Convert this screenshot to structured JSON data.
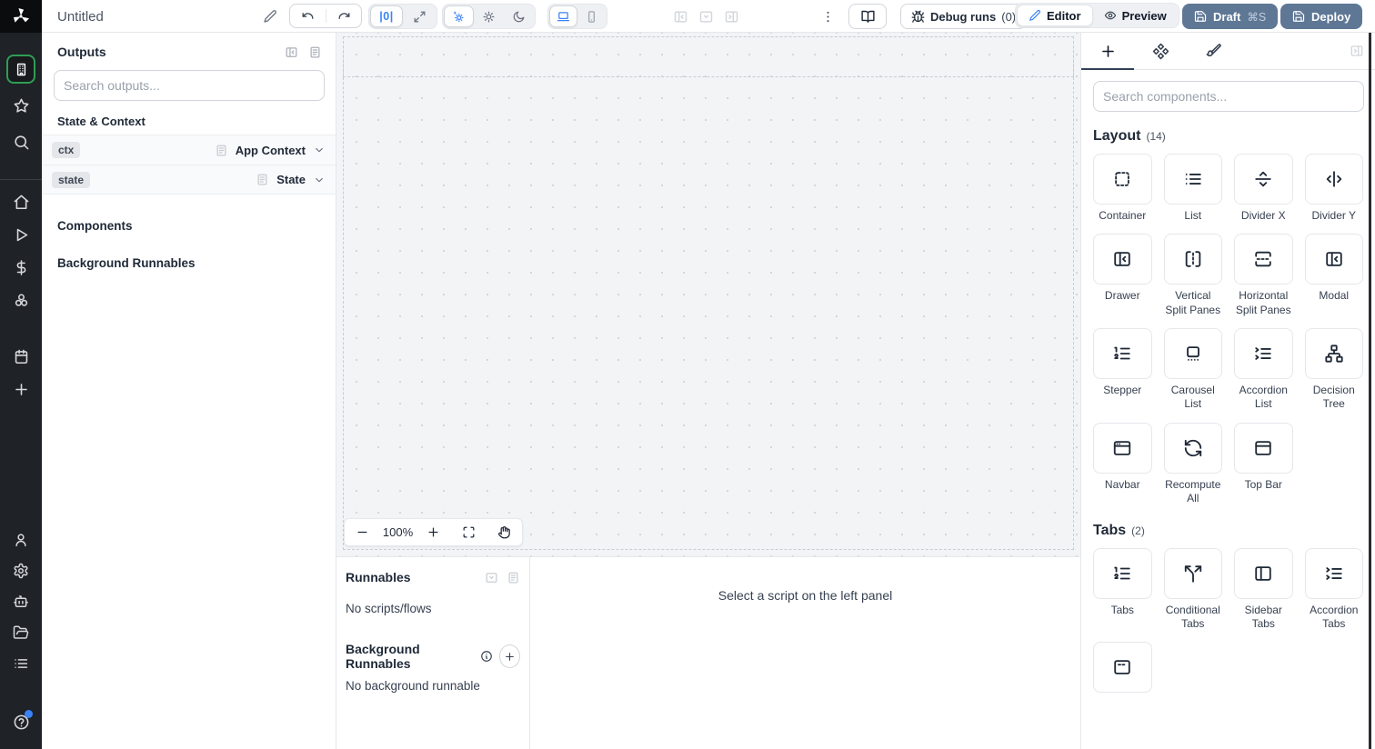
{
  "topbar": {
    "title": "Untitled",
    "zoom_reset_label": "|0|",
    "debug_runs_label": "Debug runs",
    "debug_runs_count": "(0)",
    "editor_label": "Editor",
    "preview_label": "Preview",
    "draft_label": "Draft",
    "draft_shortcut": "⌘S",
    "deploy_label": "Deploy"
  },
  "sidebar": {
    "top_icons": [
      {
        "icon": "app-builder",
        "active": true
      },
      {
        "icon": "star"
      },
      {
        "icon": "search"
      }
    ],
    "mid_icons": [
      {
        "icon": "home"
      },
      {
        "icon": "play"
      },
      {
        "icon": "dollar"
      },
      {
        "icon": "resources"
      }
    ],
    "lower_icons": [
      {
        "icon": "calendar"
      },
      {
        "icon": "plus"
      }
    ],
    "bottom_icons": [
      {
        "icon": "user"
      },
      {
        "icon": "gear"
      },
      {
        "icon": "robot"
      },
      {
        "icon": "folder"
      },
      {
        "icon": "list-menu"
      }
    ],
    "help_icon": "help"
  },
  "outputs": {
    "title": "Outputs",
    "search_placeholder": "Search outputs...",
    "state_context_header": "State & Context",
    "rows": [
      {
        "badge": "ctx",
        "label": "App Context"
      },
      {
        "badge": "state",
        "label": "State"
      }
    ],
    "components_header": "Components",
    "background_header": "Background Runnables"
  },
  "canvas": {
    "zoom_level": "100%"
  },
  "runnables": {
    "title": "Runnables",
    "no_scripts": "No scripts/flows",
    "background_title": "Background Runnables",
    "no_background": "No background runnable",
    "select_hint": "Select a script on the left panel"
  },
  "components_panel": {
    "search_placeholder": "Search components...",
    "sections": [
      {
        "title": "Layout",
        "count": "(14)",
        "items": [
          {
            "label": "Container",
            "icon": "container"
          },
          {
            "label": "List",
            "icon": "list"
          },
          {
            "label": "Divider X",
            "icon": "divider-x"
          },
          {
            "label": "Divider Y",
            "icon": "divider-y"
          },
          {
            "label": "Drawer",
            "icon": "drawer"
          },
          {
            "label": "Vertical Split Panes",
            "icon": "vsplit"
          },
          {
            "label": "Horizontal Split Panes",
            "icon": "hsplit"
          },
          {
            "label": "Modal",
            "icon": "modal"
          },
          {
            "label": "Stepper",
            "icon": "stepper"
          },
          {
            "label": "Carousel List",
            "icon": "carousel"
          },
          {
            "label": "Accordion List",
            "icon": "accordion-list"
          },
          {
            "label": "Decision Tree",
            "icon": "decision-tree"
          },
          {
            "label": "Navbar",
            "icon": "navbar"
          },
          {
            "label": "Recompute All",
            "icon": "recompute"
          },
          {
            "label": "Top Bar",
            "icon": "top-bar"
          }
        ]
      },
      {
        "title": "Tabs",
        "count": "(2)",
        "items": [
          {
            "label": "Tabs",
            "icon": "tabs"
          },
          {
            "label": "Conditional Tabs",
            "icon": "conditional-tabs"
          },
          {
            "label": "Sidebar Tabs",
            "icon": "sidebar-tabs"
          },
          {
            "label": "Accordion Tabs",
            "icon": "accordion-tabs"
          },
          {
            "label": "",
            "icon": "invisible-tabs"
          }
        ]
      }
    ]
  },
  "colors": {
    "accent_blue": "#3b82f6",
    "deploy_button": "#5e7795",
    "sidebar_bg": "#1f2227",
    "selected_green": "#2e9e54",
    "canvas_bg": "#f3f4f6"
  }
}
